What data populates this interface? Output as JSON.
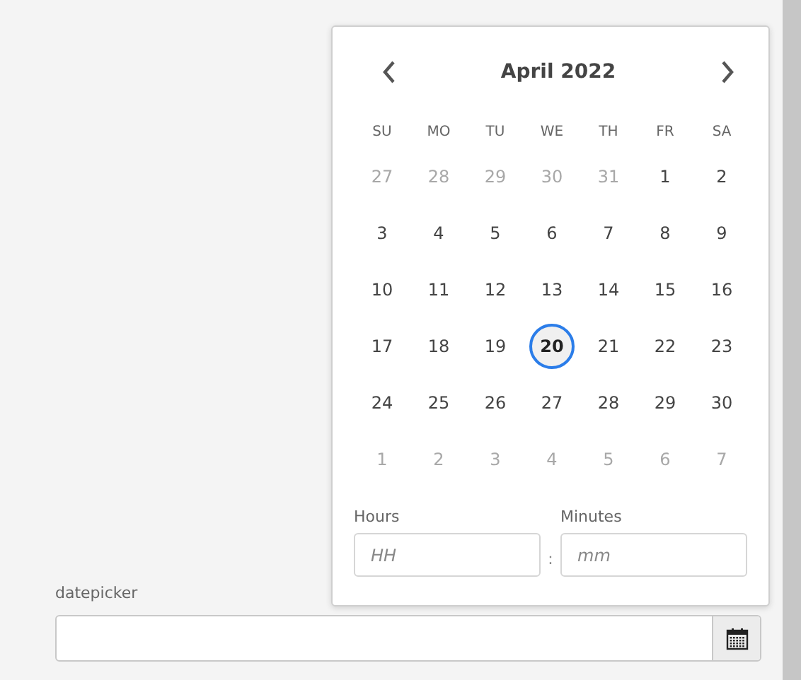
{
  "field": {
    "label": "datepicker"
  },
  "calendar": {
    "title": "April 2022",
    "weekdays": [
      "SU",
      "MO",
      "TU",
      "WE",
      "TH",
      "FR",
      "SA"
    ],
    "weeks": [
      [
        {
          "day": "27",
          "outside": true,
          "selected": false
        },
        {
          "day": "28",
          "outside": true,
          "selected": false
        },
        {
          "day": "29",
          "outside": true,
          "selected": false
        },
        {
          "day": "30",
          "outside": true,
          "selected": false
        },
        {
          "day": "31",
          "outside": true,
          "selected": false
        },
        {
          "day": "1",
          "outside": false,
          "selected": false
        },
        {
          "day": "2",
          "outside": false,
          "selected": false
        }
      ],
      [
        {
          "day": "3",
          "outside": false,
          "selected": false
        },
        {
          "day": "4",
          "outside": false,
          "selected": false
        },
        {
          "day": "5",
          "outside": false,
          "selected": false
        },
        {
          "day": "6",
          "outside": false,
          "selected": false
        },
        {
          "day": "7",
          "outside": false,
          "selected": false
        },
        {
          "day": "8",
          "outside": false,
          "selected": false
        },
        {
          "day": "9",
          "outside": false,
          "selected": false
        }
      ],
      [
        {
          "day": "10",
          "outside": false,
          "selected": false
        },
        {
          "day": "11",
          "outside": false,
          "selected": false
        },
        {
          "day": "12",
          "outside": false,
          "selected": false
        },
        {
          "day": "13",
          "outside": false,
          "selected": false
        },
        {
          "day": "14",
          "outside": false,
          "selected": false
        },
        {
          "day": "15",
          "outside": false,
          "selected": false
        },
        {
          "day": "16",
          "outside": false,
          "selected": false
        }
      ],
      [
        {
          "day": "17",
          "outside": false,
          "selected": false
        },
        {
          "day": "18",
          "outside": false,
          "selected": false
        },
        {
          "day": "19",
          "outside": false,
          "selected": false
        },
        {
          "day": "20",
          "outside": false,
          "selected": true
        },
        {
          "day": "21",
          "outside": false,
          "selected": false
        },
        {
          "day": "22",
          "outside": false,
          "selected": false
        },
        {
          "day": "23",
          "outside": false,
          "selected": false
        }
      ],
      [
        {
          "day": "24",
          "outside": false,
          "selected": false
        },
        {
          "day": "25",
          "outside": false,
          "selected": false
        },
        {
          "day": "26",
          "outside": false,
          "selected": false
        },
        {
          "day": "27",
          "outside": false,
          "selected": false
        },
        {
          "day": "28",
          "outside": false,
          "selected": false
        },
        {
          "day": "29",
          "outside": false,
          "selected": false
        },
        {
          "day": "30",
          "outside": false,
          "selected": false
        }
      ],
      [
        {
          "day": "1",
          "outside": true,
          "selected": false
        },
        {
          "day": "2",
          "outside": true,
          "selected": false
        },
        {
          "day": "3",
          "outside": true,
          "selected": false
        },
        {
          "day": "4",
          "outside": true,
          "selected": false
        },
        {
          "day": "5",
          "outside": true,
          "selected": false
        },
        {
          "day": "6",
          "outside": true,
          "selected": false
        },
        {
          "day": "7",
          "outside": true,
          "selected": false
        }
      ]
    ],
    "hours": {
      "label": "Hours",
      "placeholder": "HH"
    },
    "separator": ":",
    "minutes": {
      "label": "Minutes",
      "placeholder": "mm"
    }
  }
}
